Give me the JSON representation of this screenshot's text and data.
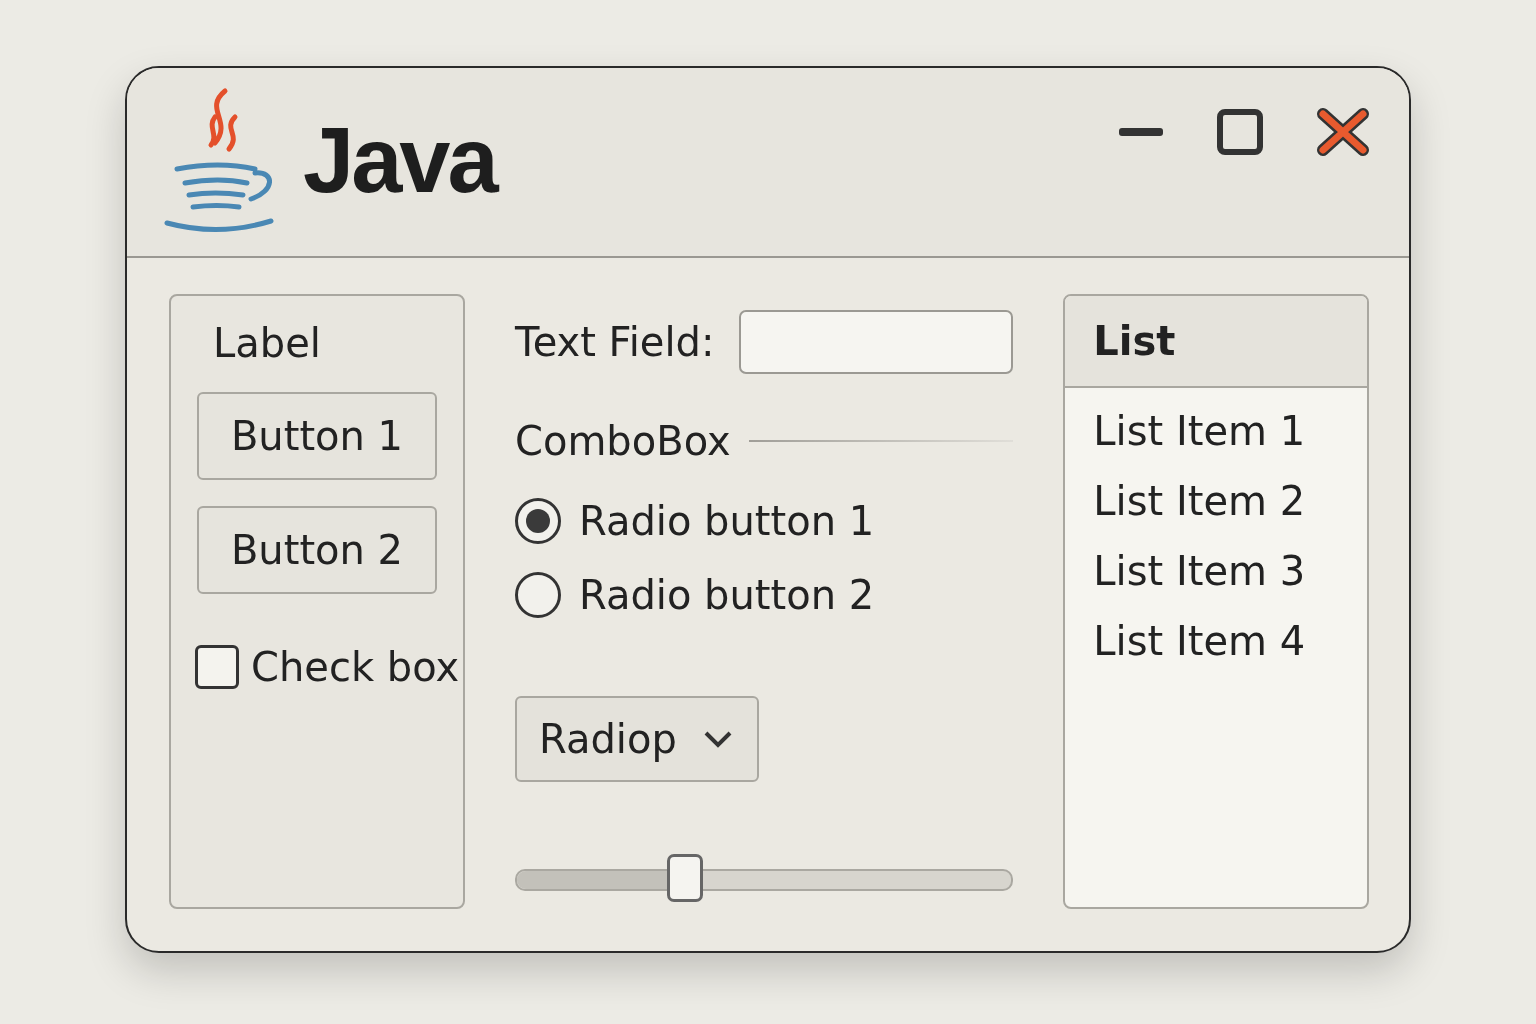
{
  "window": {
    "title": "Java"
  },
  "left_panel": {
    "label": "Label",
    "buttons": [
      "Button 1",
      "Button 2"
    ],
    "checkbox": {
      "label": "Check box",
      "checked": false
    }
  },
  "text_field": {
    "label": "Text Field:"
  },
  "combobox": {
    "label": "ComboBox"
  },
  "radios": [
    {
      "label": "Radio button 1",
      "selected": true
    },
    {
      "label": "Radio button 2",
      "selected": false
    }
  ],
  "dropdown": {
    "value": "Radiop"
  },
  "slider": {
    "level": 0.34
  },
  "list": {
    "title": "List",
    "items": [
      "List Item 1",
      "List Item 2",
      "List Item 3",
      "List Item 4"
    ]
  }
}
